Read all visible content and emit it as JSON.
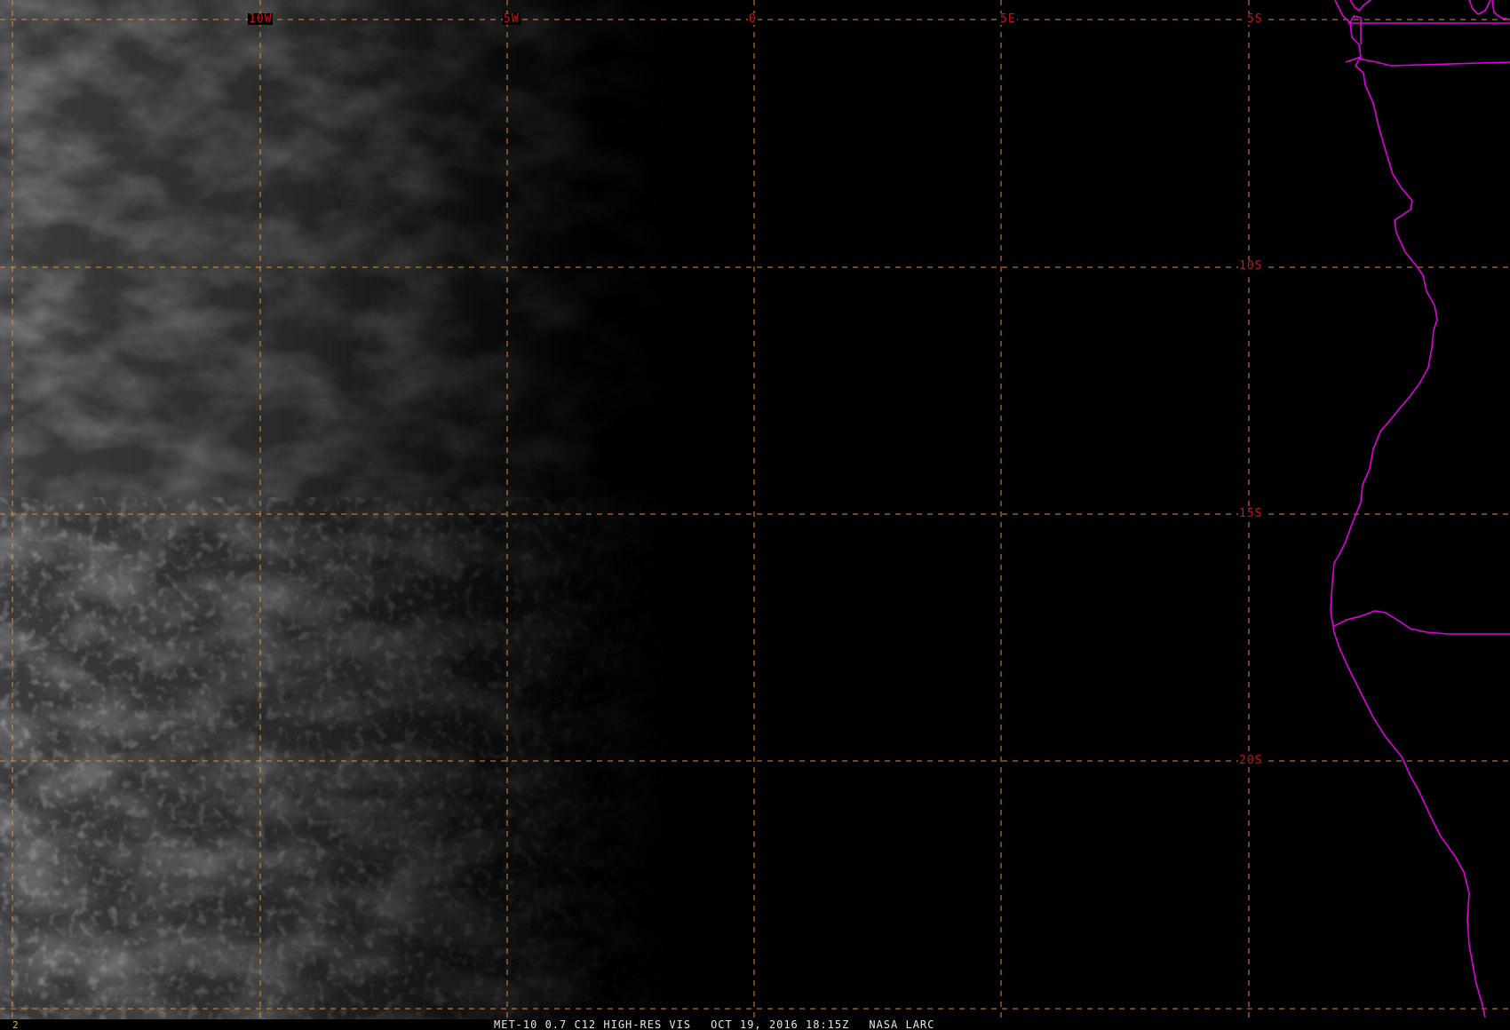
{
  "map": {
    "longitude_labels": [
      "10W",
      "5W",
      "0",
      "5E"
    ],
    "latitude_labels": [
      "5S",
      "10S",
      "15S",
      "20S"
    ],
    "grid_color": "#e08c3c",
    "label_color": "#c81414",
    "boundary_color": "#e000e0",
    "land_color": "#000000"
  },
  "status": {
    "frame_number": "2",
    "product": "MET-10 0.7 C12 HIGH-RES VIS",
    "datetime": "OCT 19, 2016 18:15Z",
    "source": "NASA LARC"
  }
}
